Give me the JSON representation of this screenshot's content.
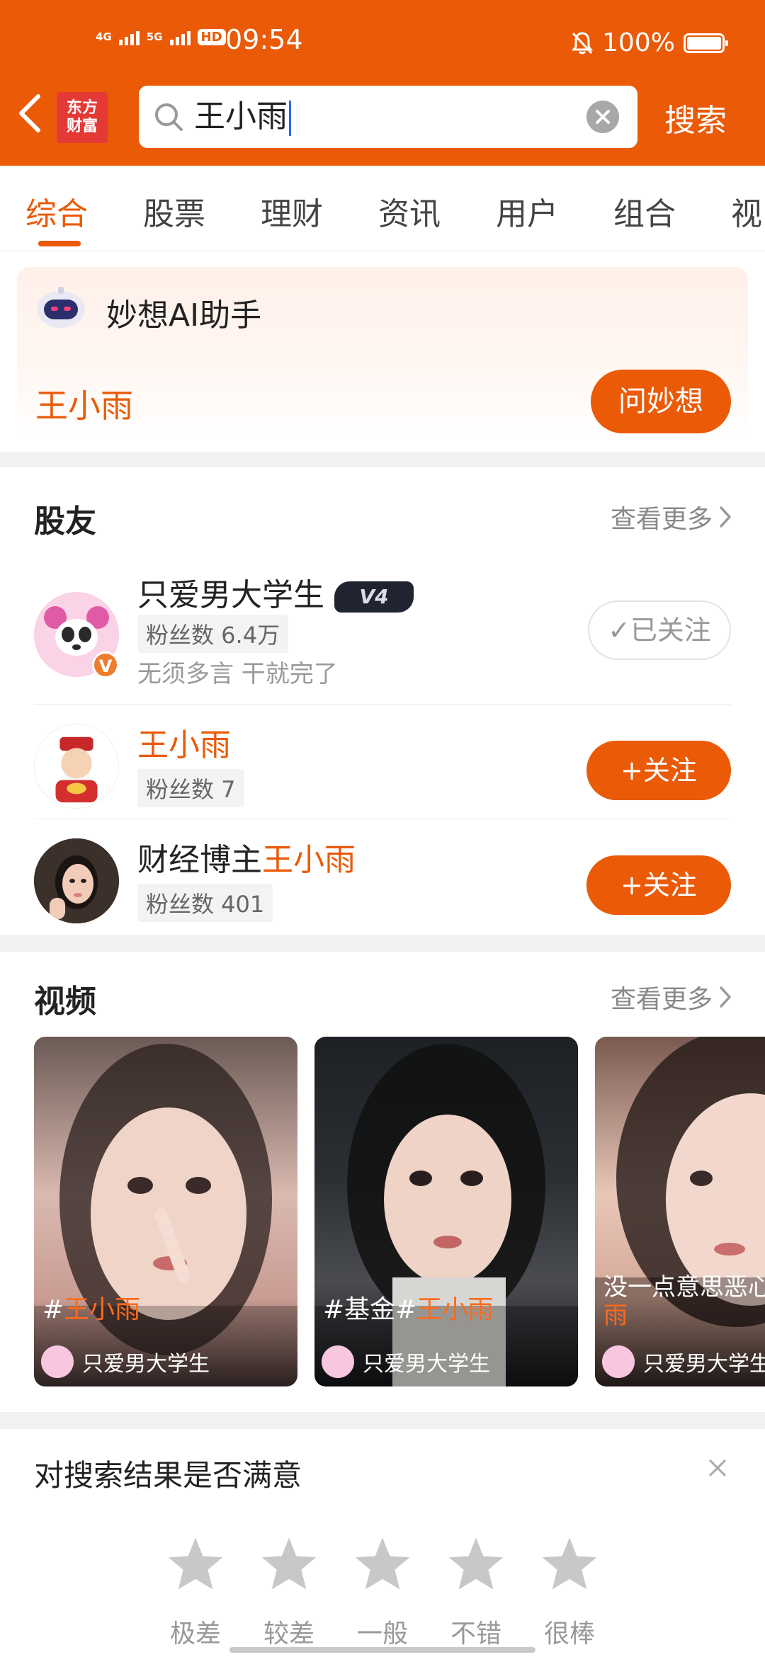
{
  "status_bar": {
    "net1": "4G",
    "net2": "5G",
    "hd": "HD",
    "time": "09:54",
    "battery": "100%"
  },
  "header": {
    "logo_line1": "东方",
    "logo_line2": "财富",
    "search_value": "王小雨",
    "search_button": "搜索"
  },
  "tabs": [
    "综合",
    "股票",
    "理财",
    "资讯",
    "用户",
    "组合",
    "视"
  ],
  "ai_card": {
    "title": "妙想AI助手",
    "query": "王小雨",
    "button": "问妙想"
  },
  "users": {
    "title": "股友",
    "more": "查看更多",
    "items": [
      {
        "name_prefix": "只爱男大学生",
        "name_highlight": "",
        "badge": "V4",
        "fans": "粉丝数 6.4万",
        "bio": "无须多言 干就完了",
        "button": "已关注",
        "followed": true
      },
      {
        "name_prefix": "",
        "name_highlight": "王小雨",
        "badge": "",
        "fans": "粉丝数 7",
        "bio": "",
        "button": "+关注",
        "followed": false
      },
      {
        "name_prefix": "财经博主",
        "name_highlight": "王小雨",
        "badge": "",
        "fans": "粉丝数 401",
        "bio": "",
        "button": "+关注",
        "followed": false
      }
    ]
  },
  "videos": {
    "title": "视频",
    "more": "查看更多",
    "items": [
      {
        "title_prefix": "#",
        "title_highlight": "王小雨",
        "author": "只爱男大学生"
      },
      {
        "title_prefix": "#基金#",
        "title_highlight": "王小雨",
        "author": "只爱男大学生"
      },
      {
        "title_prefix": "没一点意思恶心",
        "title_highlight": "雨",
        "author": "只爱男大学生"
      }
    ]
  },
  "rating": {
    "title": "对搜索结果是否满意",
    "labels": [
      "极差",
      "较差",
      "一般",
      "不错",
      "很棒"
    ]
  },
  "colors": {
    "brand": "#ea5a07",
    "star": "#c8c8c8"
  }
}
